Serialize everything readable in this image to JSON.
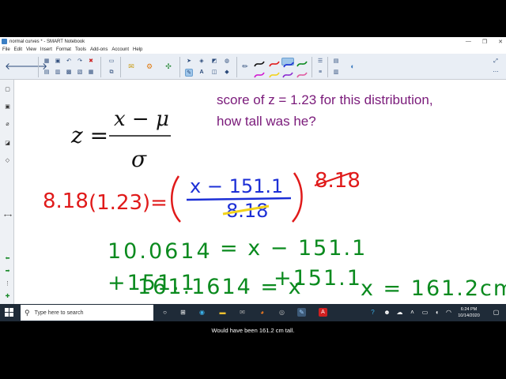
{
  "window": {
    "title": "normal curves * - SMART Notebook"
  },
  "menu": [
    "File",
    "Edit",
    "View",
    "Insert",
    "Format",
    "Tools",
    "Add-ons",
    "Account",
    "Help"
  ],
  "canvas": {
    "formula_z": "z =",
    "formula_top": "x − μ",
    "formula_bottom": "σ",
    "question_line1": "score of z = 1.23 for this distribution,",
    "question_line2": "how tall was he?",
    "ink": {
      "row1_left_factor": "8.18",
      "row1_z": "(1.23)=",
      "row1_numerator": "x − 151.1",
      "row1_denominator": "8.18",
      "row1_right_crossed": "8.18",
      "row2_left": "10.0614",
      "row2_eq": "= x − 151.1",
      "row3_add_left": "+151.1",
      "row3_add_right": "+151.1",
      "row4_result": "161.1614 = x",
      "row4_final": "x = 161.2cm"
    },
    "colors": {
      "green_ink": "#0a8a1e",
      "red_ink": "#e01a1a",
      "blue_ink": "#1c2fd6",
      "yellow_strike": "#f2d21b",
      "question_text": "#7a1a7a"
    }
  },
  "taskbar": {
    "search_placeholder": "Type here to search",
    "time": "6:24 PM",
    "date": "10/14/2020"
  },
  "caption": "Would have been 161.2 cm tall."
}
